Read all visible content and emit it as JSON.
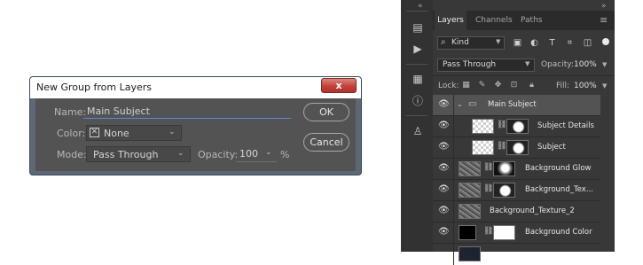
{
  "dialog": {
    "title": "New Group from Layers",
    "close_glyph": "x",
    "name_label": "Name:",
    "name_value": "Main Subject",
    "color_label": "Color:",
    "color_value": "None",
    "mode_label": "Mode:",
    "mode_value": "Pass Through",
    "opacity_label": "Opacity:",
    "opacity_value": "100",
    "opacity_unit": "%",
    "ok_label": "OK",
    "cancel_label": "Cancel"
  },
  "panel": {
    "collapse_glyph": "«",
    "tabs": [
      "Layers",
      "Channels",
      "Paths"
    ],
    "menu_glyph": "≡",
    "filter_kind": "Kind",
    "blend_mode": "Pass Through",
    "opacity_label": "Opacity:",
    "opacity_value": "100%",
    "lock_label": "Lock:",
    "fill_label": "Fill:",
    "fill_value": "100%",
    "layers": [
      {
        "name": "Main Subject",
        "type": "group"
      },
      {
        "name": "Subject Details",
        "type": "masked-checker"
      },
      {
        "name": "Subject",
        "type": "masked-checker"
      },
      {
        "name": "Background Glow",
        "type": "masked-texture"
      },
      {
        "name": "Background_Tex...",
        "type": "masked-texture"
      },
      {
        "name": "Background_Texture_2",
        "type": "texture"
      },
      {
        "name": "Background Color",
        "type": "fill"
      }
    ]
  },
  "icons": {
    "side": [
      "brush-settings-icon",
      "play-icon",
      "properties-icon",
      "info-icon",
      "clone-source-icon"
    ],
    "filter": [
      "pixel-filter-icon",
      "adjustment-filter-icon",
      "type-filter-icon",
      "shape-filter-icon",
      "smart-object-filter-icon"
    ],
    "lock": [
      "lock-transparency-icon",
      "lock-image-icon",
      "lock-position-icon",
      "lock-artboard-icon",
      "lock-all-icon"
    ]
  },
  "colors": {
    "dialog_bg": "#535353",
    "panel_bg": "#383838",
    "selected_row": "#535353",
    "close_red": "#c4413a"
  }
}
